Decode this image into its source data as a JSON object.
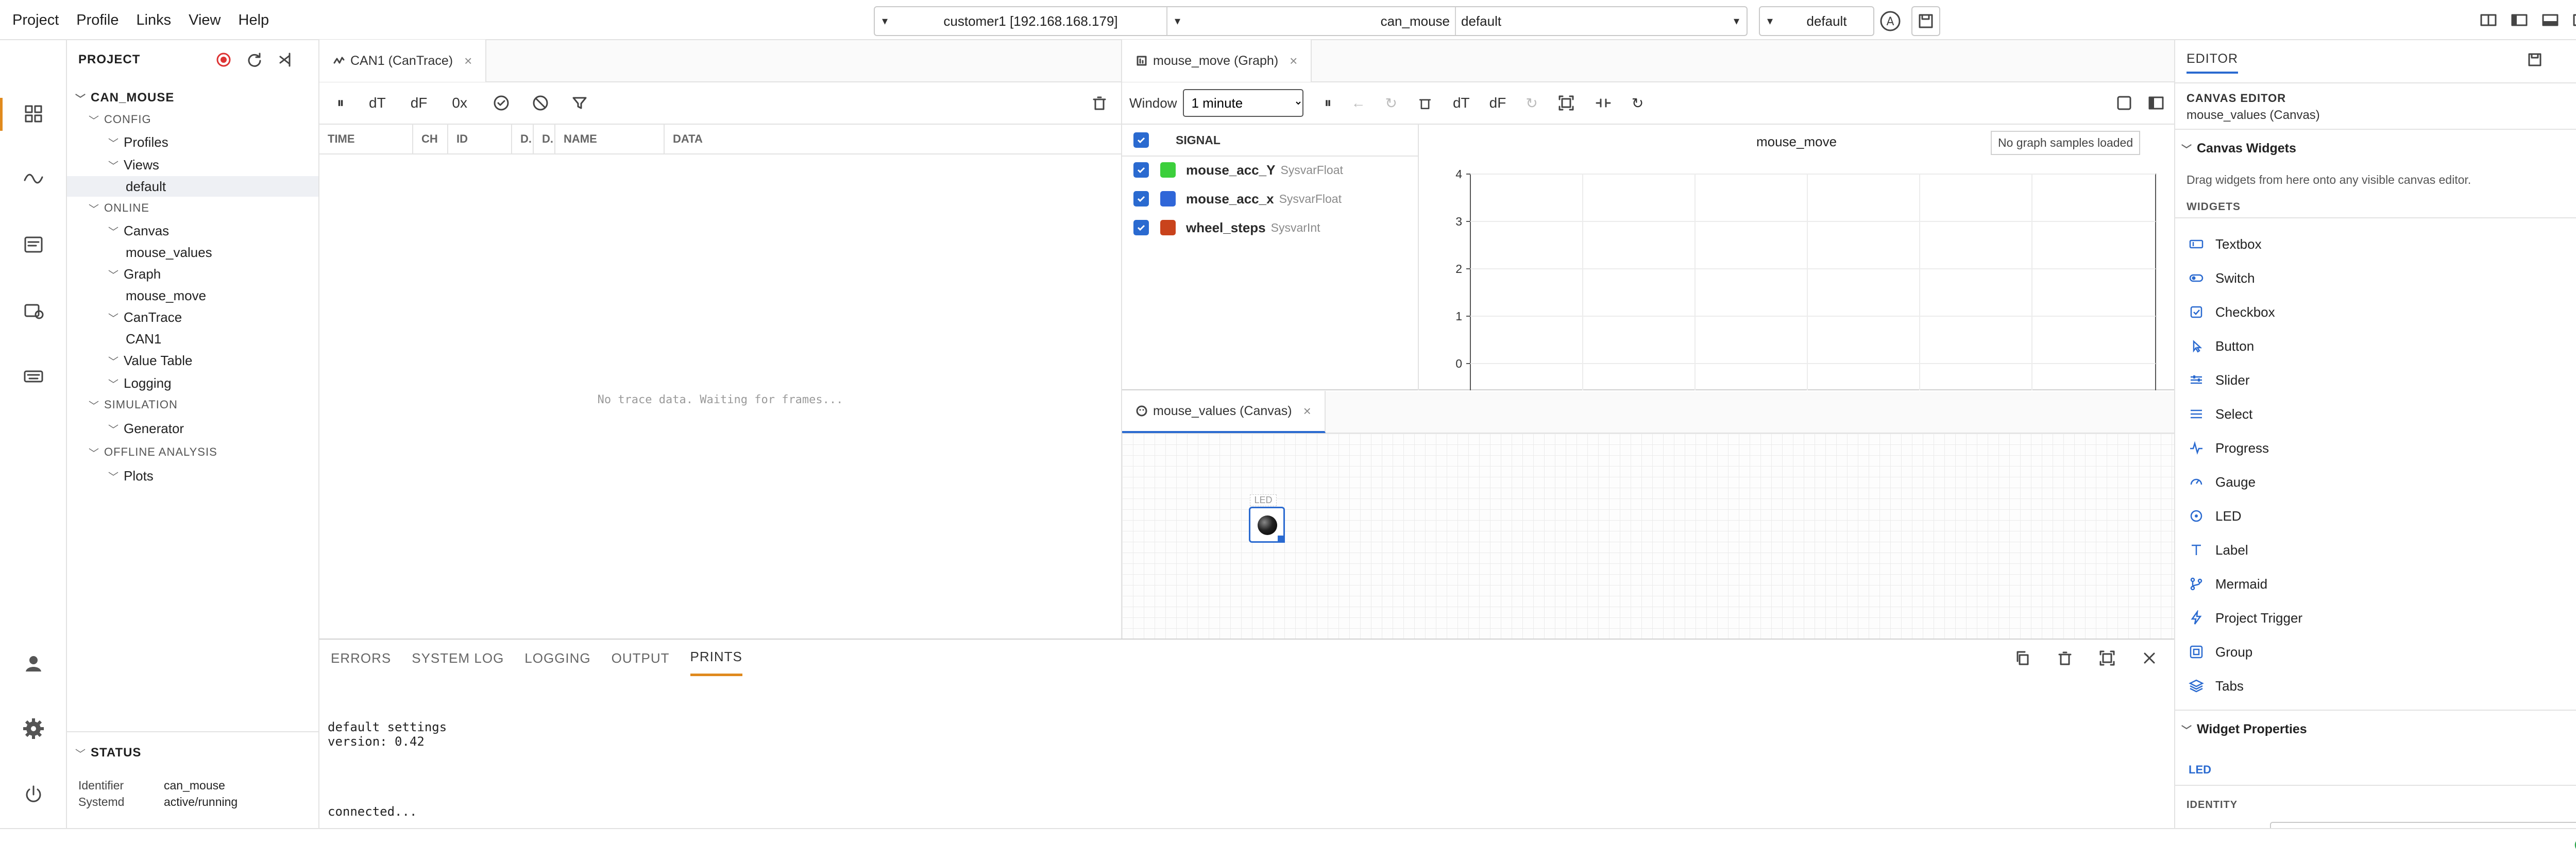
{
  "menu": {
    "project": "Project",
    "profile": "Profile",
    "links": "Links",
    "view": "View",
    "help": "Help"
  },
  "connection": {
    "target": "customer1 [192.168.168.179]",
    "project": "can_mouse",
    "profile": "default",
    "view": "default"
  },
  "project": {
    "title": "PROJECT",
    "root": "CAN_MOUSE",
    "config": "CONFIG",
    "profiles": "Profiles",
    "views": "Views",
    "views_default": "default",
    "online": "ONLINE",
    "canvas": "Canvas",
    "canvas_item": "mouse_values",
    "graph": "Graph",
    "graph_item": "mouse_move",
    "cantrace": "CanTrace",
    "cantrace_item": "CAN1",
    "value_table": "Value Table",
    "logging": "Logging",
    "simulation": "SIMULATION",
    "generator": "Generator",
    "offline": "OFFLINE ANALYSIS",
    "plots": "Plots"
  },
  "status": {
    "title": "STATUS",
    "identifier_label": "Identifier",
    "identifier_value": "can_mouse",
    "systemd_label": "Systemd",
    "systemd_value": "active/running"
  },
  "cantrace": {
    "tab": "CAN1 (CanTrace)",
    "toolbar": {
      "dt": "dT",
      "df": "dF",
      "hex": "0x"
    },
    "columns": [
      "TIME",
      "CH",
      "ID",
      "D.",
      "D.",
      "NAME",
      "DATA"
    ],
    "empty": "No trace data. Waiting for frames..."
  },
  "graph": {
    "tab": "mouse_move (Graph)",
    "window_label": "Window",
    "window_value": "1 minute",
    "window_options": [
      "1 minute"
    ],
    "toolbar": {
      "dt": "dT",
      "df": "dF"
    },
    "signal_header": "SIGNAL",
    "signals": [
      {
        "name": "mouse_acc_Y",
        "type": "SysvarFloat",
        "color": "#3ccf3c"
      },
      {
        "name": "mouse_acc_x",
        "type": "SysvarFloat",
        "color": "#2f66d8"
      },
      {
        "name": "wheel_steps",
        "type": "SysvarInt",
        "color": "#c9431c"
      }
    ],
    "chart_title": "mouse_move",
    "no_samples": "No graph samples loaded",
    "ticks": [
      "4",
      "3",
      "2",
      "1",
      "0"
    ]
  },
  "chart_data": {
    "type": "line",
    "title": "mouse_move",
    "series": [
      {
        "name": "mouse_acc_Y",
        "values": []
      },
      {
        "name": "mouse_acc_x",
        "values": []
      },
      {
        "name": "wheel_steps",
        "values": []
      }
    ],
    "yticks": [
      4,
      3,
      2,
      1,
      0
    ],
    "grid": true
  },
  "canvas": {
    "tab": "mouse_values (Canvas)",
    "led_label": "LED"
  },
  "bottom": {
    "tabs": [
      "ERRORS",
      "SYSTEM LOG",
      "LOGGING",
      "OUTPUT",
      "PRINTS"
    ],
    "active_tab": "PRINTS",
    "lines": [
      "default settings",
      "version: 0.42",
      "connected..."
    ]
  },
  "editor": {
    "title": "EDITOR",
    "subtitle": "CANVAS EDITOR",
    "target": "mouse_values (Canvas)",
    "canvas_widgets_header": "Canvas Widgets",
    "hint": "Drag widgets from here onto any visible canvas editor.",
    "widgets_header": "WIDGETS",
    "widgets": [
      "Textbox",
      "Switch",
      "Checkbox",
      "Button",
      "Slider",
      "Select",
      "Progress",
      "Gauge",
      "LED",
      "Label",
      "Mermaid",
      "Project Trigger",
      "Group",
      "Tabs"
    ],
    "widget_props_header": "Widget Properties",
    "selected_widget": "LED",
    "identity": "IDENTITY"
  }
}
